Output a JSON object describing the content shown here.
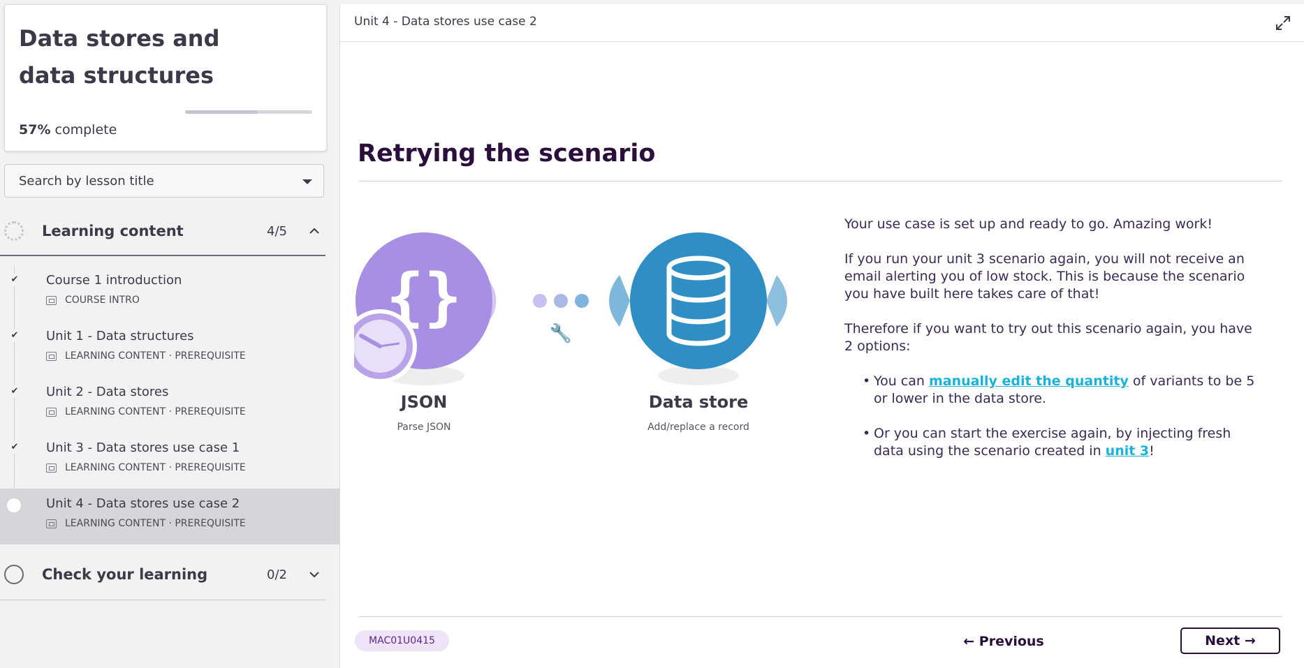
{
  "course": {
    "title": "Data stores and data structures",
    "progress_value": "57%",
    "progress_suffix": " complete",
    "progress_fraction": 0.57
  },
  "search": {
    "placeholder": "Search by lesson title"
  },
  "sections": [
    {
      "title": "Learning content",
      "count": "4/5",
      "chevron": "chevron-up-icon",
      "expanded": true
    },
    {
      "title": "Check your learning",
      "count": "0/2",
      "chevron": "chevron-down-icon",
      "expanded": false
    }
  ],
  "lessons": [
    {
      "name": "Course 1 introduction",
      "meta": "COURSE INTRO",
      "status": "done"
    },
    {
      "name": "Unit 1 - Data structures",
      "meta": "LEARNING CONTENT · PREREQUISITE",
      "status": "done"
    },
    {
      "name": "Unit 2 - Data stores",
      "meta": "LEARNING CONTENT · PREREQUISITE",
      "status": "done"
    },
    {
      "name": "Unit 3 - Data stores use case 1",
      "meta": "LEARNING CONTENT · PREREQUISITE",
      "status": "done"
    },
    {
      "name": "Unit 4 - Data stores use case 2",
      "meta": "LEARNING CONTENT · PREREQUISITE",
      "status": "current"
    }
  ],
  "main": {
    "breadcrumb": "Unit 4 - Data stores use case 2",
    "heading": "Retrying the scenario",
    "diagram": {
      "module1": {
        "label": "JSON",
        "sub": "Parse JSON",
        "color": "#a98fe3"
      },
      "module2": {
        "label": "Data store",
        "sub": "Add/replace a record",
        "color": "#2f8fc4"
      }
    },
    "paragraphs": [
      "Your use case is set up and ready to go. Amazing work!",
      "If you run your unit 3 scenario again, you will not receive an email alerting you of low stock. This is because the scenario you have built here takes care of that!",
      "Therefore if you want to try out this scenario again, you have 2 options:"
    ],
    "bullet1": {
      "before": "You can ",
      "link": "manually edit the quantity",
      "after": " of variants to be 5 or lower in the data store."
    },
    "bullet2": {
      "before": "Or you can start the exercise again, by injecting fresh data using the scenario created in ",
      "link": "unit 3",
      "after": "!"
    },
    "code": "MAC01U0415",
    "prev_label": "← Previous",
    "next_label": "Next →"
  },
  "colors": {
    "accent": "#2a0f3d",
    "link": "#19b3d9",
    "chip_bg": "#efe3f7"
  }
}
